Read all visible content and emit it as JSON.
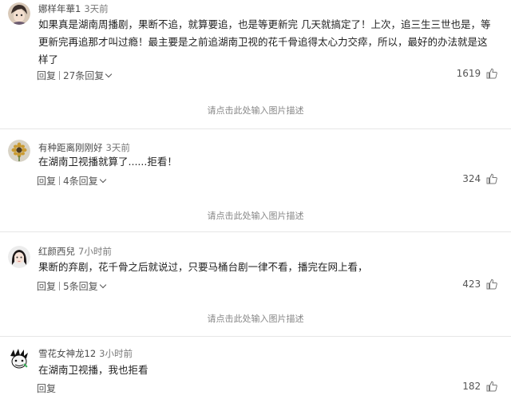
{
  "comments": [
    {
      "username": "娜样年華1",
      "time": "3天前",
      "text": "如果真是湖南周播剧，果断不追，就算要追，也是等更新完 几天就搞定了！上次，追三生三世也是，等更新完再追那才叫过瘾！最主要是之前追湖南卫视的花千骨追得太心力交瘁，所以，最好的办法就是这样了",
      "reply_label": "回复",
      "replies_label": "27条回复",
      "likes": "1619",
      "avatar_icon": "anime-avatar-icon"
    },
    {
      "username": "有种距离刚刚好",
      "time": "3天前",
      "text": "在湖南卫视播就算了......拒看！",
      "reply_label": "回复",
      "replies_label": "4条回复",
      "likes": "324",
      "avatar_icon": "sunflower-avatar-icon"
    },
    {
      "username": "红颜西兒",
      "time": "7小时前",
      "text": "果断的弃剧，花千骨之后就说过，只要马桶台剧一律不看，播完在网上看，",
      "reply_label": "回复",
      "replies_label": "5条回复",
      "likes": "423",
      "avatar_icon": "girl-avatar-icon"
    },
    {
      "username": "雪花女神龙12",
      "time": "3小时前",
      "text": "在湖南卫视播，我也拒看",
      "reply_label": "回复",
      "likes": "182",
      "avatar_icon": "cartoon-avatar-icon"
    }
  ],
  "image_caption": "请点击此处输入图片描述",
  "colors": {
    "text": "#222222",
    "meta": "#777777",
    "caption": "#888888"
  }
}
